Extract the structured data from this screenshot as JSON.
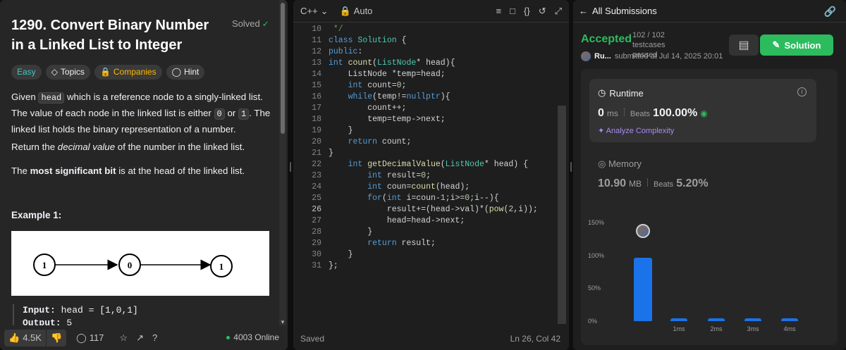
{
  "problem": {
    "title": "1290. Convert Binary Number in a Linked List to Integer",
    "status": "Solved",
    "tags": [
      "Easy",
      "Topics",
      "Companies",
      "Hint"
    ],
    "para1_a": "Given ",
    "para1_code1": "head",
    "para1_b": " which is a reference node to a singly-linked list. The value of each node in the linked list is either ",
    "para1_code2": "0",
    "para1_c": " or ",
    "para1_code3": "1",
    "para1_d": ". The linked list holds the binary representation of a number.",
    "para2_a": "Return the ",
    "para2_em": "decimal value",
    "para2_b": " of the number in the linked list.",
    "para3_a": "The ",
    "para3_strong": "most significant bit",
    "para3_b": " is at the head of the linked list.",
    "example_title": "Example 1:",
    "diagram_nodes": [
      "1",
      "0",
      "1"
    ],
    "input_label": "Input:",
    "input_value": "head = [1,0,1]",
    "output_label": "Output:",
    "output_value": "5"
  },
  "footer": {
    "likes": "4.5K",
    "comments": "117",
    "online": "4003 Online"
  },
  "editor": {
    "language": "C++",
    "mode": "Auto",
    "status": "Saved",
    "cursor": "Ln 26, Col 42",
    "current_line": 26,
    "lines": [
      {
        "n": "10",
        "html": "<span class='cm'> */</span>"
      },
      {
        "n": "11",
        "html": "<span class='kw'>class</span> <span class='ty'>Solution</span> {"
      },
      {
        "n": "12",
        "html": "<span class='kw'>public</span>:"
      },
      {
        "n": "13",
        "html": "<span class='kw'>int</span> <span class='fn'>count</span>(<span class='ty'>ListNode</span>* head){"
      },
      {
        "n": "14",
        "html": "    ListNode *temp=head;"
      },
      {
        "n": "15",
        "html": "    <span class='kw'>int</span> count=<span class='nm'>0</span>;"
      },
      {
        "n": "16",
        "html": "    <span class='kw'>while</span>(temp!=<span class='kw'>nullptr</span>){"
      },
      {
        "n": "17",
        "html": "        count++;"
      },
      {
        "n": "18",
        "html": "        temp=temp->next;"
      },
      {
        "n": "19",
        "html": "    }"
      },
      {
        "n": "20",
        "html": "    <span class='kw'>return</span> count;"
      },
      {
        "n": "21",
        "html": "}"
      },
      {
        "n": "22",
        "html": "    <span class='kw'>int</span> <span class='fn'>getDecimalValue</span>(<span class='ty'>ListNode</span>* head) {"
      },
      {
        "n": "23",
        "html": "        <span class='kw'>int</span> result=<span class='nm'>0</span>;"
      },
      {
        "n": "24",
        "html": "        <span class='kw'>int</span> coun=<span class='fn'>count</span>(head);"
      },
      {
        "n": "25",
        "html": "        <span class='kw'>for</span>(<span class='kw'>int</span> i=coun-<span class='nm'>1</span>;i>=<span class='nm'>0</span>;i--){"
      },
      {
        "n": "26",
        "html": "            result+=(head->val)*(<span class='fn'>pow</span>(<span class='nm'>2</span>,i));"
      },
      {
        "n": "27",
        "html": "            head=head->next;"
      },
      {
        "n": "28",
        "html": "        }"
      },
      {
        "n": "29",
        "html": "        <span class='kw'>return</span> result;"
      },
      {
        "n": "30",
        "html": "    }"
      },
      {
        "n": "31",
        "html": "};"
      }
    ]
  },
  "submission": {
    "back_label": "All Submissions",
    "result": "Accepted",
    "testcases": "102 / 102 testcases passed",
    "user": "Ru...",
    "submitted": "submitted at Jul 14, 2025 20:01",
    "solution_label": "Solution",
    "runtime_label": "Runtime",
    "runtime_value": "0",
    "runtime_unit": "ms",
    "beats_label": "Beats",
    "runtime_beats": "100.00%",
    "analyze_label": "Analyze Complexity",
    "memory_label": "Memory",
    "memory_value": "10.90",
    "memory_unit": "MB",
    "memory_beats": "5.20%"
  },
  "chart_data": {
    "type": "bar",
    "categories": [
      "",
      "1ms",
      "2ms",
      "3ms",
      "4ms"
    ],
    "values": [
      96,
      3,
      3,
      3,
      3
    ],
    "ylim": [
      0,
      150
    ],
    "yticks": [
      "0%",
      "50%",
      "100%",
      "150%"
    ],
    "bar_color": "#1a73e8"
  },
  "colors": {
    "accent_green": "#2cbb5d",
    "easy": "#46c6c2",
    "companies": "#ffb800"
  }
}
